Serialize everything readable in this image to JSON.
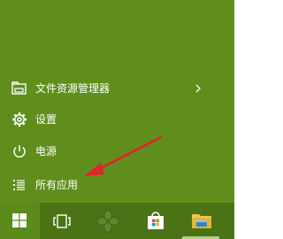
{
  "colors": {
    "panel_background": "#5f8e1c",
    "taskbar_background": "#497314",
    "text": "#ffffff",
    "annotation_arrow": "#e2242b"
  },
  "start_menu": {
    "items": [
      {
        "label": "文件资源管理器",
        "icon": "file-explorer-icon",
        "has_submenu": true
      },
      {
        "label": "设置",
        "icon": "gear-icon"
      },
      {
        "label": "电源",
        "icon": "power-icon"
      },
      {
        "label": "所有应用",
        "icon": "all-apps-list-icon"
      }
    ]
  },
  "taskbar": {
    "buttons": [
      {
        "icon": "windows-start-icon",
        "active": true
      },
      {
        "icon": "task-view-icon"
      },
      {
        "icon": "pinned-app-icon"
      },
      {
        "icon": "store-icon"
      },
      {
        "icon": "file-explorer-icon",
        "running": true
      }
    ]
  }
}
